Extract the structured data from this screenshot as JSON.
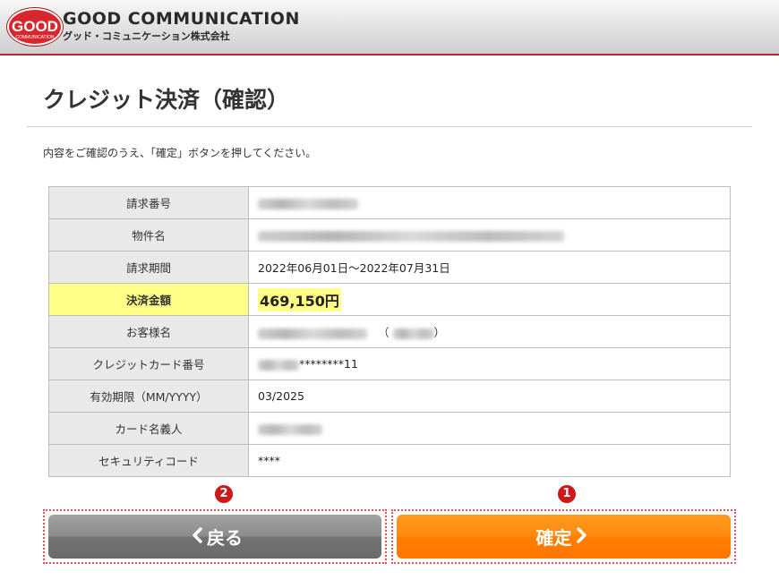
{
  "header": {
    "logo_text": "GOOD",
    "logo_subtext": "COMMUNICATION",
    "company_name_en": "GOOD COMMUNICATION",
    "company_name_jp": "グッド・コミュニケーション株式会社"
  },
  "page": {
    "title": "クレジット決済（確認）",
    "instruction": "内容をご確認のうえ、「確定」ボタンを押してください。"
  },
  "table": {
    "rows": [
      {
        "label": "請求番号"
      },
      {
        "label": "物件名"
      },
      {
        "label": "請求期間",
        "value": "2022年06月01日～2022年07月31日"
      },
      {
        "label": "決済金額",
        "value": "469,150円"
      },
      {
        "label": "お客様名"
      },
      {
        "label": "クレジットカード番号",
        "value": "********11"
      },
      {
        "label": "有効期限（MM/YYYY）",
        "value": "03/2025"
      },
      {
        "label": "カード名義人"
      },
      {
        "label": "セキュリティコード",
        "value": "****"
      }
    ],
    "paren_open": "（",
    "paren_close": "）"
  },
  "buttons": {
    "back_label": "戻る",
    "confirm_label": "確定",
    "back_badge": "2",
    "confirm_badge": "1"
  },
  "colors": {
    "header_line": "#b8282d",
    "highlight": "#ffff88",
    "confirm_button": "#ff7e00",
    "back_button": "#7a7a7a",
    "badge": "#cc1a1a"
  }
}
